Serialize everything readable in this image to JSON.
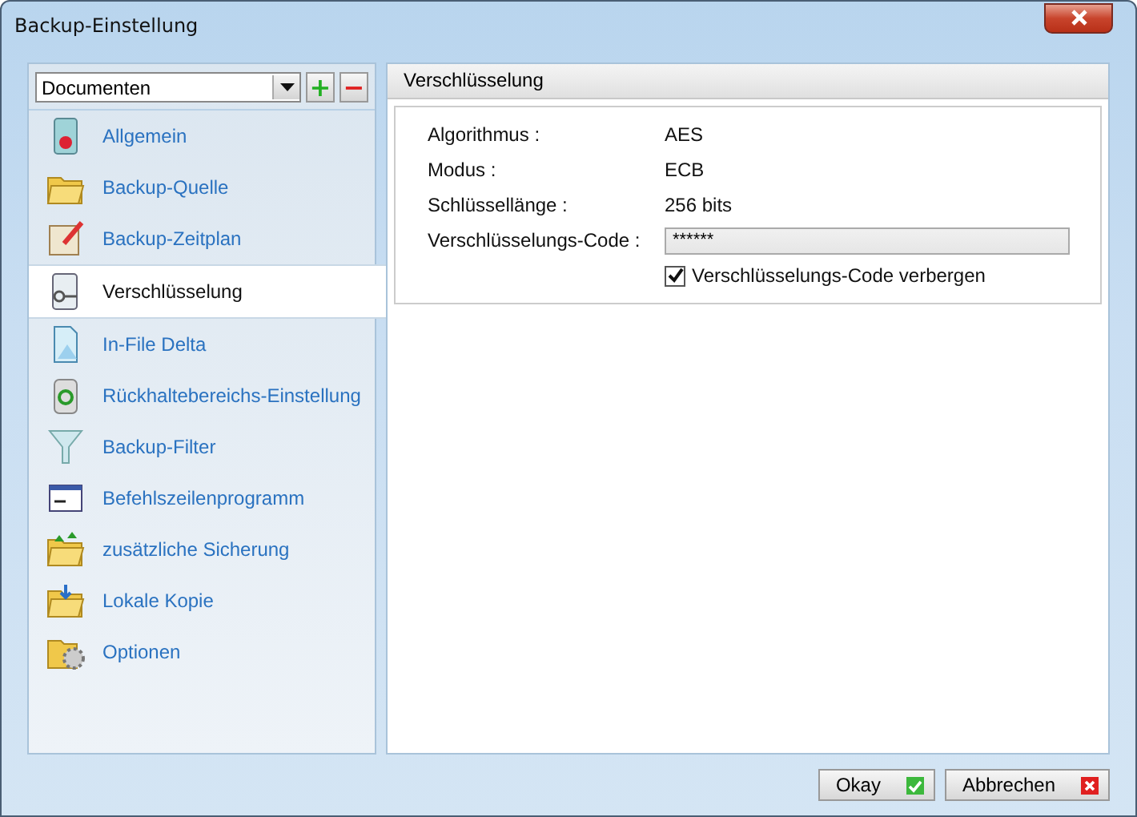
{
  "window": {
    "title": "Backup-Einstellung"
  },
  "profile": {
    "value": "Documenten",
    "add": "+",
    "remove": "−"
  },
  "sidebar": {
    "items": [
      {
        "label": "Allgemein",
        "selected": false
      },
      {
        "label": "Backup-Quelle",
        "selected": false
      },
      {
        "label": "Backup-Zeitplan",
        "selected": false
      },
      {
        "label": "Verschlüsselung",
        "selected": true
      },
      {
        "label": "In-File Delta",
        "selected": false
      },
      {
        "label": "Rückhaltebereichs-Einstellung",
        "selected": false
      },
      {
        "label": "Backup-Filter",
        "selected": false
      },
      {
        "label": "Befehlszeilenprogramm",
        "selected": false
      },
      {
        "label": "zusätzliche Sicherung",
        "selected": false
      },
      {
        "label": "Lokale Kopie",
        "selected": false
      },
      {
        "label": "Optionen",
        "selected": false
      }
    ]
  },
  "panel": {
    "title": "Verschlüsselung",
    "fields": [
      {
        "kind": "text",
        "label": "Algorithmus :",
        "value": "AES"
      },
      {
        "kind": "text",
        "label": "Modus :",
        "value": "ECB"
      },
      {
        "kind": "text",
        "label": "Schlüssellänge :",
        "value": "256 bits"
      },
      {
        "kind": "input",
        "label": "Verschlüsselungs-Code :",
        "value": "******"
      }
    ],
    "checkbox": {
      "label": "Verschlüsselungs-Code verbergen",
      "checked": true
    }
  },
  "buttons": [
    {
      "label": "Okay",
      "kind": "ok"
    },
    {
      "label": "Abbrechen",
      "kind": "cancel"
    }
  ]
}
